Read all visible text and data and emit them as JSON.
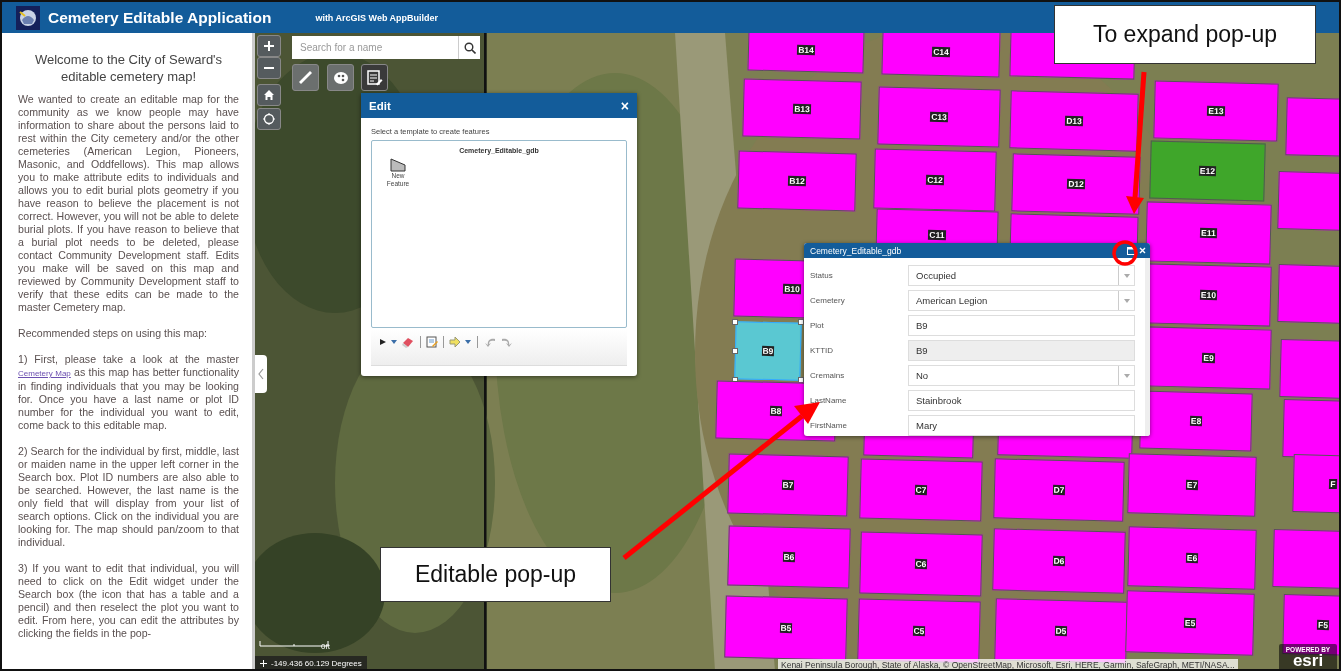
{
  "header": {
    "title": "Cemetery Editable Application",
    "subtitle": "with ArcGIS Web AppBuilder"
  },
  "sidebar": {
    "heading": "Welcome to the City of Seward's editable cemetery map!",
    "paragraphs": [
      {
        "text": "We wanted to create an editable map for the community as we know people may have information to share about the persons laid to rest within the City cemetery and/or the other cemeteries (American Legion, Pioneers, Masonic, and Oddfellows). This map allows you to make attribute edits to individuals and allows you to edit burial plots geometry if you have reason to believe the placement is not correct. However, you will not be able to delete burial plots. If you have reason to believe that a burial plot needs to be deleted, please contact Community Development staff. Edits you make will be saved on this map and reviewed by Community Development staff to verify that these edits can be made to the master Cemetery map."
      },
      {
        "text": "Recommended steps on using this map:"
      },
      {
        "text": "1) First, please take a look at the master",
        "link": "Cemetery Map",
        "text_after": "as this map has better functionality in finding individuals that you may be looking for. Once you have a last name or plot ID number for the individual you want to edit, come back to this editable map."
      },
      {
        "text": "2) Search for the individual by first, middle, last or maiden name in the upper left corner in the Search box. Plot ID numbers are also able to be searched. However, the last name is the only field that will display from your list of search options. Click on the individual you are looking for. The map should pan/zoom to that individual."
      },
      {
        "text": "3) If you want to edit that individual, you will need to click on the Edit widget under the Search box (the icon that has a table and a pencil) and then reselect the plot you want to edit. From here, you can edit the attributes by clicking the fields in the pop-"
      }
    ]
  },
  "search": {
    "placeholder": "Search for a name"
  },
  "map_tools": [
    {
      "kind": "measure",
      "selected": false
    },
    {
      "kind": "palette",
      "selected": false
    },
    {
      "kind": "edit",
      "selected": true
    }
  ],
  "edit_panel": {
    "title": "Edit",
    "close": "×",
    "hint": "Select a template to create features",
    "layer": "Cemetery_Editable_gdb",
    "templates": [
      {
        "label": "New Feature"
      }
    ]
  },
  "plots": [
    {
      "label": "B14",
      "color": "#ff00ff",
      "selected": false
    },
    {
      "label": "C14",
      "color": "#ff00ff",
      "selected": false
    },
    {
      "color": "#ff00ff",
      "selected": false
    },
    {
      "label": "B13",
      "color": "#ff00ff",
      "selected": false
    },
    {
      "label": "C13",
      "color": "#ff00ff",
      "selected": false
    },
    {
      "label": "D13",
      "color": "#ff00ff",
      "selected": false
    },
    {
      "label": "E13",
      "color": "#ff00ff",
      "selected": false
    },
    {
      "color": "#ff00ff",
      "selected": false
    },
    {
      "label": "B12",
      "color": "#ff00ff",
      "selected": false
    },
    {
      "label": "C12",
      "color": "#ff00ff",
      "selected": false
    },
    {
      "label": "D12",
      "color": "#ff00ff",
      "selected": false
    },
    {
      "label": "E12",
      "color": "#3fa62a",
      "selected": false
    },
    {
      "color": "#ff00ff",
      "selected": false
    },
    {
      "label": "C11",
      "color": "#ff00ff",
      "selected": false
    },
    {
      "color": "#ff00ff",
      "selected": false
    },
    {
      "label": "E11",
      "color": "#ff00ff",
      "selected": false
    },
    {
      "label": "B10",
      "color": "#ff00ff",
      "selected": false
    },
    {
      "label": "E10",
      "color": "#ff00ff",
      "selected": false
    },
    {
      "color": "#ff00ff",
      "selected": false
    },
    {
      "label": "B9",
      "color": "#5ac8d2",
      "selected": true
    },
    {
      "label": "E9",
      "color": "#ff00ff",
      "selected": false
    },
    {
      "color": "#ff00ff",
      "selected": false
    },
    {
      "label": "B8",
      "color": "#ff00ff",
      "selected": false
    },
    {
      "color": "#ff00ff",
      "selected": false
    },
    {
      "color": "#ff00ff",
      "selected": false
    },
    {
      "label": "E8",
      "color": "#ff00ff",
      "selected": false
    },
    {
      "color": "#ff00ff",
      "selected": false
    },
    {
      "label": "B7",
      "color": "#ff00ff",
      "selected": false
    },
    {
      "label": "C7",
      "color": "#ff00ff",
      "selected": false
    },
    {
      "label": "D7",
      "color": "#ff00ff",
      "selected": false
    },
    {
      "label": "E7",
      "color": "#ff00ff",
      "selected": false
    },
    {
      "label": "F",
      "color": "#ff00ff",
      "selected": false
    },
    {
      "label": "B6",
      "color": "#ff00ff",
      "selected": false
    },
    {
      "label": "C6",
      "color": "#ff00ff",
      "selected": false
    },
    {
      "label": "D6",
      "color": "#ff00ff",
      "selected": false
    },
    {
      "label": "E6",
      "color": "#ff00ff",
      "selected": false
    },
    {
      "color": "#ff00ff",
      "selected": false
    },
    {
      "label": "B5",
      "color": "#ff00ff",
      "selected": false
    },
    {
      "label": "C5",
      "color": "#ff00ff",
      "selected": false
    },
    {
      "label": "D5",
      "color": "#ff00ff",
      "selected": false
    },
    {
      "label": "E5",
      "color": "#ff00ff",
      "selected": false
    },
    {
      "label": "F5",
      "color": "#ff00ff",
      "selected": false
    }
  ],
  "popup": {
    "title": "Cemetery_Editable_gdb",
    "fields": [
      {
        "label": "Status",
        "value": "Occupied",
        "kind": "dropdown"
      },
      {
        "label": "Cemetery",
        "value": "American Legion",
        "kind": "dropdown"
      },
      {
        "label": "Plot",
        "value": "B9",
        "kind": "text"
      },
      {
        "label": "KTTID",
        "value": "B9",
        "kind": "readonly"
      },
      {
        "label": "Cremains",
        "value": "No",
        "kind": "dropdown"
      },
      {
        "label": "LastName",
        "value": "Stainbrook",
        "kind": "text"
      },
      {
        "label": "FirstName",
        "value": "Mary",
        "kind": "text"
      }
    ]
  },
  "scale_label": "0ft",
  "coordinates": "-149.436 60.129 Degrees",
  "attribution": "Kenai Peninsula Borough, State of Alaska, © OpenStreetMap, Microsoft, Esri, HERE, Garmin, SafeGraph, METI/NASA...",
  "esri_logo": {
    "line1": "POWERED BY",
    "line2": "esri"
  },
  "annotations": [
    {
      "text": "To expand pop-up"
    },
    {
      "text": "Editable pop-up"
    }
  ]
}
